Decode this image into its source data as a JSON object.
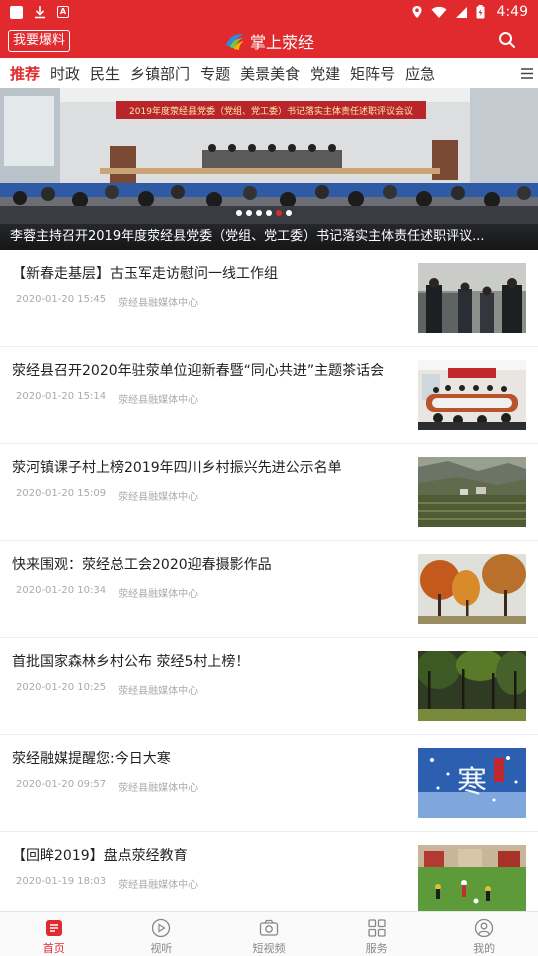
{
  "status_bar": {
    "time": "4:49"
  },
  "header": {
    "report_label": "我要爆料",
    "title": "掌上荥经"
  },
  "tabs": [
    {
      "label": "推荐",
      "active": true
    },
    {
      "label": "时政"
    },
    {
      "label": "民生"
    },
    {
      "label": "乡镇部门"
    },
    {
      "label": "专题"
    },
    {
      "label": "美景美食"
    },
    {
      "label": "党建"
    },
    {
      "label": "矩阵号"
    },
    {
      "label": "应急"
    }
  ],
  "hero": {
    "banner_text": "2019年度荥经县党委（党组、党工委）书记落实主体责任述职评议会议",
    "caption": "李蓉主持召开2019年度荥经县党委（党组、党工委）书记落实主体责任述职评议...",
    "slide_count": 6,
    "active_slide": 5
  },
  "news": [
    {
      "title": "【新春走基层】古玉军走访慰问一线工作组",
      "time": "2020-01-20 15:45",
      "source": "荥经县融媒体中心",
      "thumb": "meeting-outdoor"
    },
    {
      "title": "荥经县召开2020年驻荥单位迎新春暨“同心共进”主题茶话会",
      "time": "2020-01-20 15:14",
      "source": "荥经县融媒体中心",
      "thumb": "conference-room"
    },
    {
      "title": "荥河镇课子村上榜2019年四川乡村振兴先进公示名单",
      "time": "2020-01-20 15:09",
      "source": "荥经县融媒体中心",
      "thumb": "village-landscape"
    },
    {
      "title": "快来围观：荥经总工会2020迎春摄影作品",
      "time": "2020-01-20 10:34",
      "source": "荥经县融媒体中心",
      "thumb": "autumn-trees"
    },
    {
      "title": "首批国家森林乡村公布 荥经5村上榜！",
      "time": "2020-01-20 10:25",
      "source": "荥经县融媒体中心",
      "thumb": "forest"
    },
    {
      "title": "荥经融媒提醒您:今日大寒",
      "time": "2020-01-20 09:57",
      "source": "荥经县融媒体中心",
      "thumb": "dahan-poster"
    },
    {
      "title": "【回眸2019】盘点荥经教育",
      "time": "2020-01-19 18:03",
      "source": "荥经县融媒体中心",
      "thumb": "sports-field"
    }
  ],
  "dahan_char": "寒",
  "bottom_nav": [
    {
      "label": "首页",
      "icon": "home-icon",
      "active": true
    },
    {
      "label": "视听",
      "icon": "play-icon"
    },
    {
      "label": "短视频",
      "icon": "camera-icon"
    },
    {
      "label": "服务",
      "icon": "grid-icon"
    },
    {
      "label": "我的",
      "icon": "user-icon"
    }
  ],
  "colors": {
    "brand_red": "#e02a2e",
    "meta_gray": "#aaaaaa"
  }
}
